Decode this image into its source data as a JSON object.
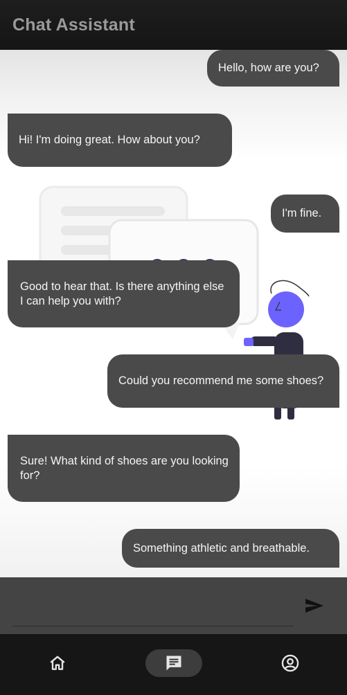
{
  "app": {
    "title": "Chat Assistant"
  },
  "messages": [
    {
      "sender": "user",
      "text": "Hello, how are you?"
    },
    {
      "sender": "bot",
      "text": "Hi! I'm doing great. How about you?"
    },
    {
      "sender": "user",
      "text": "I'm fine."
    },
    {
      "sender": "bot",
      "text": "Good to hear that. Is there anything else I can help you with?"
    },
    {
      "sender": "user",
      "text": "Could you recommend me some shoes?"
    },
    {
      "sender": "bot",
      "text": "Sure! What kind of shoes are you looking for?"
    },
    {
      "sender": "user",
      "text": "Something athletic and breathable."
    }
  ],
  "input": {
    "value": "",
    "placeholder": ""
  },
  "nav": {
    "items": [
      {
        "icon": "home-icon",
        "active": false
      },
      {
        "icon": "chat-icon",
        "active": true
      },
      {
        "icon": "account-icon",
        "active": false
      }
    ]
  },
  "colors": {
    "accent": "#6c63ff",
    "bubble": "#4a4a4a",
    "app_bar": "#1b1b1b",
    "nav_bar": "#161616",
    "input_bar": "#444444"
  }
}
